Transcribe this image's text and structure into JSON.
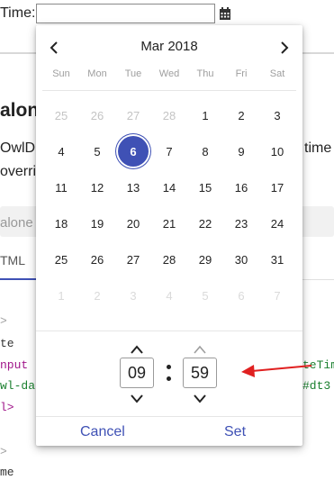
{
  "page": {
    "time_label": "Time:",
    "input_value": "",
    "heading": "alon",
    "desc_line1": "OwlD",
    "desc_line1_right": "time",
    "desc_line2": "overri",
    "search_placeholder": "alone",
    "tab_label": "TML",
    "accent_color": "#3f51b5"
  },
  "code_lines": [
    {
      "text": ">"
    },
    {
      "text": "te"
    },
    {
      "text": "nput"
    },
    {
      "text": "wl-da"
    },
    {
      "text": "l>"
    },
    {
      "text": ">"
    },
    {
      "text": "me"
    }
  ],
  "code_right": [
    {
      "text": "teTim"
    },
    {
      "text": "#dt3"
    }
  ],
  "picker": {
    "month_year": "Mar 2018",
    "prev_icon": "chevron-left-icon",
    "next_icon": "chevron-right-icon",
    "weekdays": [
      "Sun",
      "Mon",
      "Tue",
      "Wed",
      "Thu",
      "Fri",
      "Sat"
    ],
    "days": [
      {
        "label": "25",
        "state": "muted"
      },
      {
        "label": "26",
        "state": "muted"
      },
      {
        "label": "27",
        "state": "muted"
      },
      {
        "label": "28",
        "state": "muted"
      },
      {
        "label": "1",
        "state": "normal"
      },
      {
        "label": "2",
        "state": "normal"
      },
      {
        "label": "3",
        "state": "normal"
      },
      {
        "label": "4",
        "state": "normal"
      },
      {
        "label": "5",
        "state": "normal"
      },
      {
        "label": "6",
        "state": "selected"
      },
      {
        "label": "7",
        "state": "normal"
      },
      {
        "label": "8",
        "state": "normal"
      },
      {
        "label": "9",
        "state": "normal"
      },
      {
        "label": "10",
        "state": "normal"
      },
      {
        "label": "11",
        "state": "normal"
      },
      {
        "label": "12",
        "state": "normal"
      },
      {
        "label": "13",
        "state": "normal"
      },
      {
        "label": "14",
        "state": "normal"
      },
      {
        "label": "15",
        "state": "normal"
      },
      {
        "label": "16",
        "state": "normal"
      },
      {
        "label": "17",
        "state": "normal"
      },
      {
        "label": "18",
        "state": "normal"
      },
      {
        "label": "19",
        "state": "normal"
      },
      {
        "label": "20",
        "state": "normal"
      },
      {
        "label": "21",
        "state": "normal"
      },
      {
        "label": "22",
        "state": "normal"
      },
      {
        "label": "23",
        "state": "normal"
      },
      {
        "label": "24",
        "state": "normal"
      },
      {
        "label": "25",
        "state": "normal"
      },
      {
        "label": "26",
        "state": "normal"
      },
      {
        "label": "27",
        "state": "normal"
      },
      {
        "label": "28",
        "state": "normal"
      },
      {
        "label": "29",
        "state": "normal"
      },
      {
        "label": "30",
        "state": "normal"
      },
      {
        "label": "31",
        "state": "normal"
      },
      {
        "label": "1",
        "state": "faint"
      },
      {
        "label": "2",
        "state": "faint"
      },
      {
        "label": "3",
        "state": "faint"
      },
      {
        "label": "4",
        "state": "faint"
      },
      {
        "label": "5",
        "state": "faint"
      },
      {
        "label": "6",
        "state": "faint"
      },
      {
        "label": "7",
        "state": "faint"
      }
    ],
    "hour": "09",
    "minute": "59",
    "cancel_label": "Cancel",
    "set_label": "Set",
    "annotation_color": "#e02020"
  }
}
